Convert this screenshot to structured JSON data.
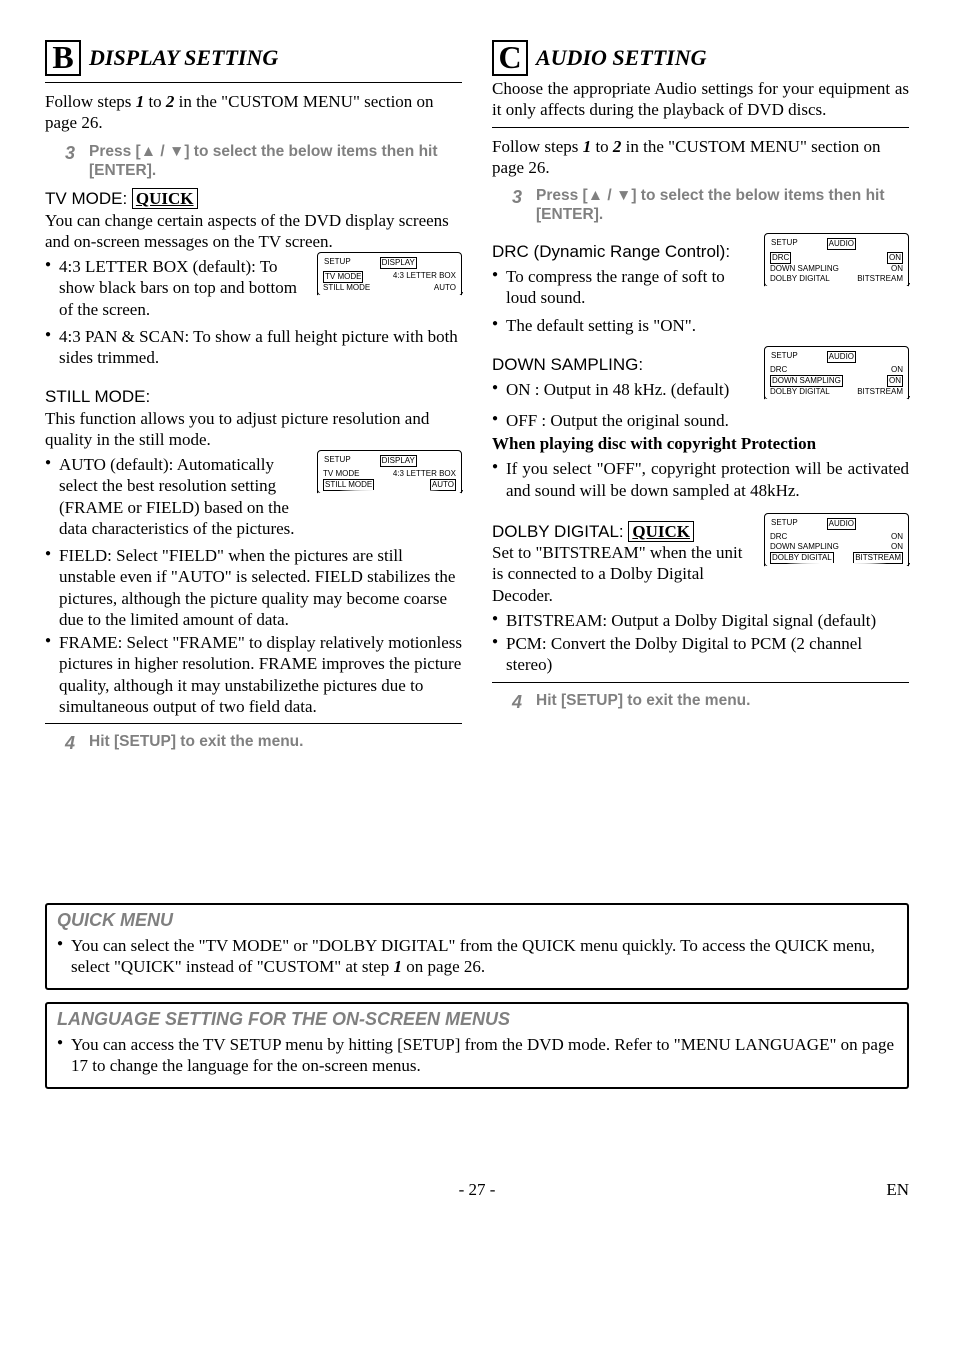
{
  "left": {
    "letter": "B",
    "title": "DISPLAY SETTING",
    "intro_a": "Follow steps ",
    "intro_1": "1",
    "intro_b": " to ",
    "intro_2": "2",
    "intro_c": " in the \"CUSTOM MENU\" section on page 26.",
    "step3_num": "3",
    "step3_text": "Press [▲ / ▼] to select the below items then hit [ENTER].",
    "tvmode_label": "TV MODE: ",
    "quick": "QUICK",
    "tvmode_desc": "You can change certain aspects of the DVD display screens and on-screen messages on the TV screen.",
    "tv_b1": "4:3 LETTER BOX (default): To show black bars on top and bottom of the screen.",
    "tv_b2": "4:3 PAN & SCAN: To show a full height picture with both sides trimmed.",
    "still_label": "STILL MODE:",
    "still_desc": "This function allows you to adjust picture resolution and quality in the still mode.",
    "still_b1": "AUTO (default): Automatically select the best resolution setting (FRAME or FIELD) based on the data characteristics of the pictures.",
    "still_b2": "FIELD: Select \"FIELD\" when the pictures are still unstable even if \"AUTO\" is selected. FIELD stabilizes the pictures, although the picture quality may become coarse due to the limited amount of data.",
    "still_b3": "FRAME: Select \"FRAME\" to display relatively motionless pictures in higher resolution. FRAME improves the picture quality, although it may unstabilizethe pictures due to simultaneous output of two field data.",
    "step4_num": "4",
    "step4_text": "Hit [SETUP] to exit the menu.",
    "osd1": {
      "tab1": "SETUP",
      "tab2": "DISPLAY",
      "r1k": "TV MODE",
      "r1v": "4:3 LETTER BOX",
      "r2k": "STILL MODE",
      "r2v": "AUTO"
    },
    "osd2": {
      "tab1": "SETUP",
      "tab2": "DISPLAY",
      "r1k": "TV MODE",
      "r1v": "4:3 LETTER BOX",
      "r2k": "STILL MODE",
      "r2v": "AUTO"
    }
  },
  "right": {
    "letter": "C",
    "title": "AUDIO SETTING",
    "intro": "Choose the appropriate Audio settings for your equipment as it only affects during the playback of DVD discs.",
    "follow_a": "Follow steps ",
    "follow_1": "1",
    "follow_b": " to ",
    "follow_2": "2",
    "follow_c": " in the \"CUSTOM MENU\" section on page 26.",
    "step3_num": "3",
    "step3_text": "Press [▲ / ▼] to select the below items then hit [ENTER].",
    "drc_label": "DRC (Dynamic Range Control):",
    "drc_b1": "To compress the range of soft to loud sound.",
    "drc_b2": "The default setting is \"ON\".",
    "down_label": "DOWN SAMPLING:",
    "down_b1": "ON : Output in 48 kHz. (default)",
    "down_b2": "OFF : Output the original sound.",
    "copy_head": "When playing disc with copyright Protection",
    "copy_b1": "If you select \"OFF\", copyright protection will be activated and sound will be down sampled at 48kHz.",
    "dolby_label": "DOLBY DIGITAL: ",
    "quick2": "QUICK",
    "dolby_desc": "Set to \"BITSTREAM\" when the unit is connected to a Dolby Digital Decoder.",
    "dolby_b1": "BITSTREAM: Output a Dolby Digital signal (default)",
    "dolby_b2": "PCM: Convert the Dolby Digital to PCM (2 channel stereo)",
    "step4_num": "4",
    "step4_text": "Hit [SETUP] to exit the menu.",
    "osdA": {
      "tab1": "SETUP",
      "tab2": "AUDIO",
      "r1k": "DRC",
      "r1v": "ON",
      "r2k": "DOWN SAMPLING",
      "r2v": "ON",
      "r3k": "DOLBY DIGITAL",
      "r3v": "BITSTREAM"
    },
    "osdB": {
      "tab1": "SETUP",
      "tab2": "AUDIO",
      "r1k": "DRC",
      "r1v": "ON",
      "r2k": "DOWN SAMPLING",
      "r2v": "ON",
      "r3k": "DOLBY DIGITAL",
      "r3v": "BITSTREAM"
    },
    "osdC": {
      "tab1": "SETUP",
      "tab2": "AUDIO",
      "r1k": "DRC",
      "r1v": "ON",
      "r2k": "DOWN SAMPLING",
      "r2v": "ON",
      "r3k": "DOLBY DIGITAL",
      "r3v": "BITSTREAM"
    }
  },
  "quick_menu": {
    "head": "QUICK MENU",
    "text_a": "You can select the \"TV MODE\" or \"DOLBY DIGITAL\" from the QUICK menu quickly. To access the QUICK menu, select \"QUICK\" instead of \"CUSTOM\" at step ",
    "text_step": "1",
    "text_b": " on page 26."
  },
  "lang_menu": {
    "head": "LANGUAGE SETTING FOR THE ON-SCREEN MENUS",
    "text": "You can access the TV SETUP menu by hitting [SETUP] from the DVD mode. Refer to \"MENU LANGUAGE\" on page 17 to change the language for the on-screen menus."
  },
  "footer": {
    "page": "- 27 -",
    "en": "EN"
  }
}
